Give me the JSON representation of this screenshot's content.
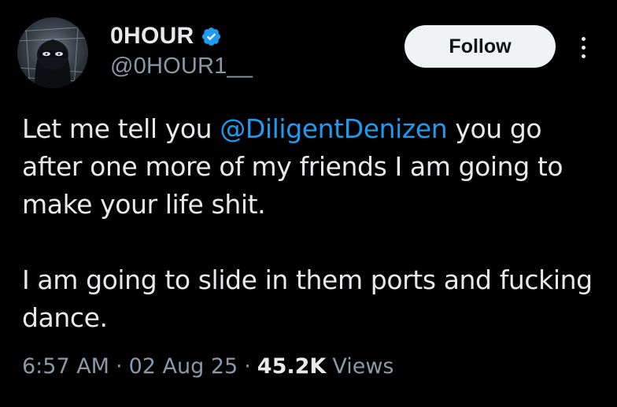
{
  "author": {
    "display_name": "0HOUR",
    "handle": "@0HOUR1__",
    "verified": true
  },
  "actions": {
    "follow_label": "Follow"
  },
  "tweet": {
    "text_before_mention": "Let me tell you ",
    "mention": "@DiligentDenizen",
    "text_after_mention": " you go after one more of my friends I am going to make your life shit.",
    "paragraph_2": "I am going to slide in them ports and fucking dance."
  },
  "meta": {
    "time": "6:57 AM",
    "separator": "·",
    "date": "02 Aug 25",
    "views_count": "45.2K",
    "views_label": "Views"
  },
  "colors": {
    "background": "#000000",
    "text_primary": "#e7e9ea",
    "text_secondary": "#8b98a5",
    "accent": "#1d9bf0",
    "button_bg": "#eff3f4"
  },
  "icons": {
    "verified": "verified-badge-icon",
    "more": "more-options-icon"
  }
}
